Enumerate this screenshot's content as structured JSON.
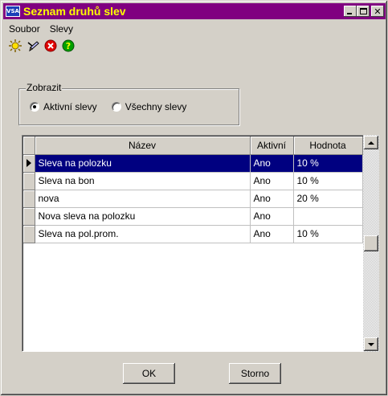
{
  "window": {
    "title": "Seznam druhů slev",
    "app_icon_label": "VSA"
  },
  "menu": [
    {
      "label": "Soubor"
    },
    {
      "label": "Slevy"
    }
  ],
  "toolbar": [
    "new-icon",
    "edit-icon",
    "delete-icon",
    "help-icon"
  ],
  "filter": {
    "legend": "Zobrazit",
    "options": [
      {
        "label": "Aktivní slevy",
        "checked": true
      },
      {
        "label": "Všechny slevy",
        "checked": false
      }
    ]
  },
  "table": {
    "columns": [
      "Název",
      "Aktivní",
      "Hodnota"
    ],
    "rows": [
      {
        "name": "Sleva na polozku",
        "active": "Ano",
        "value": "10 %",
        "selected": true
      },
      {
        "name": "Sleva na bon",
        "active": "Ano",
        "value": "10 %",
        "selected": false
      },
      {
        "name": "nova",
        "active": "Ano",
        "value": "20 %",
        "selected": false
      },
      {
        "name": "Nova sleva na polozku",
        "active": "Ano",
        "value": "",
        "selected": false
      },
      {
        "name": "Sleva na pol.prom.",
        "active": "Ano",
        "value": "10 %",
        "selected": false
      }
    ]
  },
  "buttons": {
    "ok": "OK",
    "storno": "Storno"
  },
  "colors": {
    "title_bg": "#800080",
    "title_text": "#ffff00",
    "selection": "#000080"
  }
}
